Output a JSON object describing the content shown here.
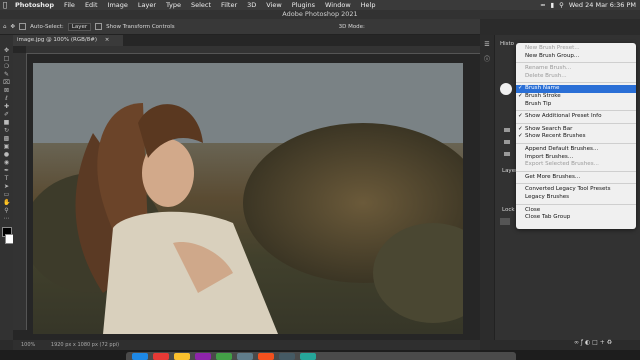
{
  "menubar": {
    "app": "Photoshop",
    "items": [
      "File",
      "Edit",
      "Image",
      "Layer",
      "Type",
      "Select",
      "Filter",
      "3D",
      "View",
      "Plugins",
      "Window",
      "Help"
    ],
    "clock": "Wed 24 Mar 6:36 PM"
  },
  "window_title": "Adobe Photoshop 2021",
  "options": {
    "auto_select": "Auto-Select:",
    "auto_select_value": "Layer",
    "show_transform": "Show Transform Controls",
    "mode": "3D Mode:"
  },
  "document": {
    "tab": "image.jpg @ 100% (RGB/8#)",
    "zoom": "100%",
    "info": "1920 px x 1080 px (72 ppi)"
  },
  "panel": {
    "tab1": "Histo",
    "label1": "Layers",
    "label2": "Lock"
  },
  "menu": {
    "items": [
      {
        "label": "New Brush Preset...",
        "disabled": true
      },
      {
        "label": "New Brush Group...",
        "disabled": false
      },
      {
        "sep": true
      },
      {
        "label": "Rename Brush...",
        "disabled": true
      },
      {
        "label": "Delete Brush...",
        "disabled": true
      },
      {
        "sep": true
      },
      {
        "label": "Brush Name",
        "checked": true,
        "selected": true
      },
      {
        "label": "Brush Stroke",
        "checked": true
      },
      {
        "label": "Brush Tip"
      },
      {
        "sep": true
      },
      {
        "label": "Show Additional Preset Info",
        "checked": true
      },
      {
        "sep": true
      },
      {
        "label": "Show Search Bar",
        "checked": true
      },
      {
        "label": "Show Recent Brushes",
        "checked": true
      },
      {
        "sep": true
      },
      {
        "label": "Append Default Brushes..."
      },
      {
        "label": "Import Brushes..."
      },
      {
        "label": "Export Selected Brushes...",
        "disabled": true
      },
      {
        "sep": true
      },
      {
        "label": "Get More Brushes..."
      },
      {
        "sep": true
      },
      {
        "label": "Converted Legacy Tool Presets"
      },
      {
        "label": "Legacy Brushes"
      },
      {
        "sep": true
      },
      {
        "label": "Close"
      },
      {
        "label": "Close Tab Group"
      }
    ]
  },
  "colors": {
    "menu_highlight": "#2a6fd6",
    "dock_icons": [
      "#1e88e5",
      "#e53935",
      "#fbc02d",
      "#8e24aa",
      "#43a047",
      "#607d8b",
      "#f4511e",
      "#455a64",
      "#26a69a"
    ]
  }
}
